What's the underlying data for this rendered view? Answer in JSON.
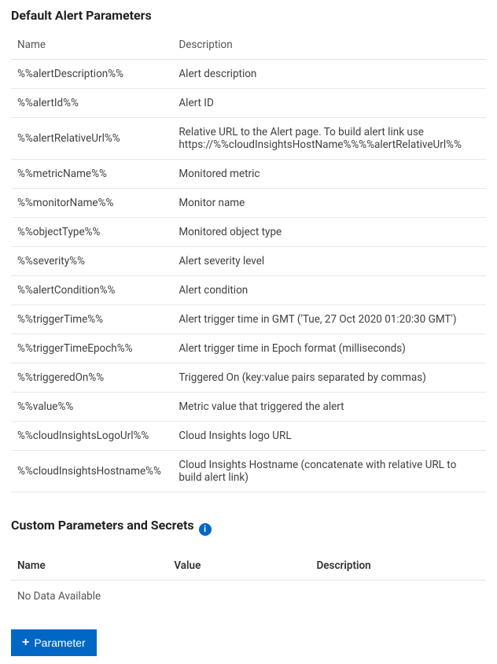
{
  "default_section": {
    "title": "Default Alert Parameters",
    "columns": {
      "name": "Name",
      "description": "Description"
    },
    "rows": [
      {
        "name": "%%alertDescription%%",
        "description": "Alert description"
      },
      {
        "name": "%%alertId%%",
        "description": "Alert ID"
      },
      {
        "name": "%%alertRelativeUrl%%",
        "description": "Relative URL to the Alert page. To build alert link use https://%%cloudInsightsHostName%%%%alertRelativeUrl%%"
      },
      {
        "name": "%%metricName%%",
        "description": "Monitored metric"
      },
      {
        "name": "%%monitorName%%",
        "description": "Monitor name"
      },
      {
        "name": "%%objectType%%",
        "description": "Monitored object type"
      },
      {
        "name": "%%severity%%",
        "description": "Alert severity level"
      },
      {
        "name": "%%alertCondition%%",
        "description": "Alert condition"
      },
      {
        "name": "%%triggerTime%%",
        "description": "Alert trigger time in GMT ('Tue, 27 Oct 2020 01:20:30 GMT')"
      },
      {
        "name": "%%triggerTimeEpoch%%",
        "description": "Alert trigger time in Epoch format (milliseconds)"
      },
      {
        "name": "%%triggeredOn%%",
        "description": "Triggered On (key:value pairs separated by commas)"
      },
      {
        "name": "%%value%%",
        "description": "Metric value that triggered the alert"
      },
      {
        "name": "%%cloudInsightsLogoUrl%%",
        "description": "Cloud Insights logo URL"
      },
      {
        "name": "%%cloudInsightsHostname%%",
        "description": "Cloud Insights Hostname (concatenate with relative URL to build alert link)"
      }
    ]
  },
  "custom_section": {
    "title": "Custom Parameters and Secrets",
    "info_icon": "info-icon",
    "columns": {
      "name": "Name",
      "value": "Value",
      "description": "Description"
    },
    "no_data": "No Data Available",
    "add_button": {
      "plus": "+",
      "label": "Parameter"
    }
  }
}
